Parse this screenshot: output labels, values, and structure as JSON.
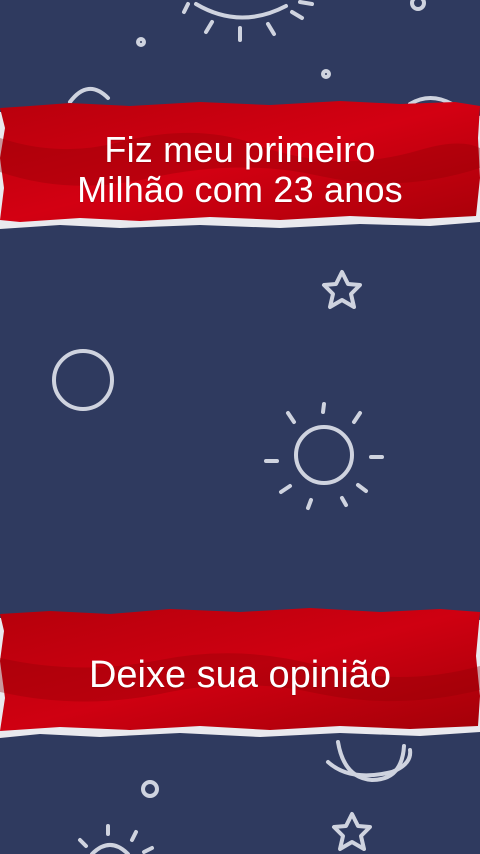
{
  "banners": {
    "top": {
      "line1": "Fiz meu primeiro",
      "line2": "Milhão com 23 anos"
    },
    "bottom": {
      "text": "Deixe sua opinião"
    }
  },
  "colors": {
    "background": "#2f3a5f",
    "banner_red": "#c8000e",
    "banner_red_dark": "#8f0006",
    "paper_edge": "#e9e9ee",
    "doodle": "#cfd3df",
    "text": "#ffffff"
  },
  "decorations": [
    "sun-icon",
    "circle-icon",
    "star-icon",
    "planet-icon",
    "dot-icon"
  ]
}
